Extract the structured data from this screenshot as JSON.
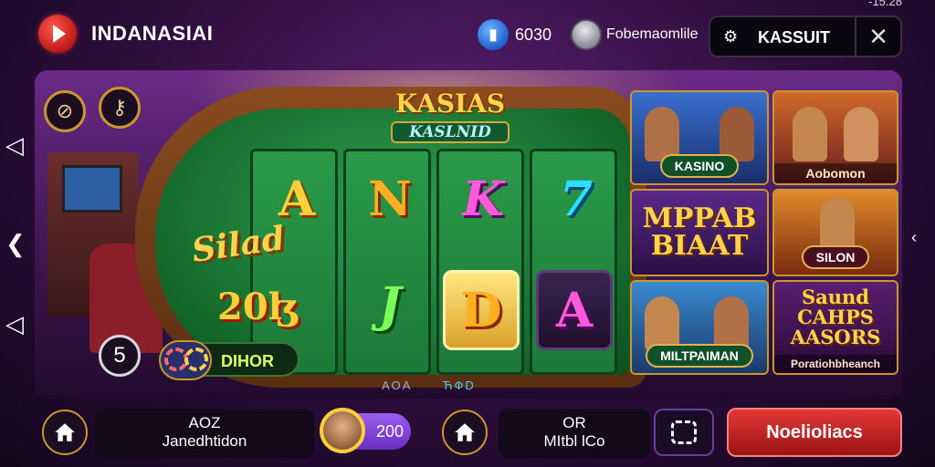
{
  "header": {
    "app_title": "INDANASIAI",
    "status_text": "-15.28",
    "coin_value": "6030",
    "user_name": "Fobemaomlile",
    "account_label": "KASSUIT",
    "close_glyph": "✕"
  },
  "game": {
    "title": "KASIAS",
    "subtitle": "KASLNID",
    "jackpot_label": "Silad",
    "jackpot_number": "20ɮ",
    "reels": [
      {
        "top": "A",
        "bottom": ""
      },
      {
        "top": "N",
        "bottom": "J"
      },
      {
        "top": "K",
        "bottom": "D"
      },
      {
        "top": "7",
        "bottom": "A"
      }
    ],
    "level": "5",
    "bonus_label": "DIHOR",
    "footer_left": "AOA",
    "footer_right": "ЋФD"
  },
  "tiles": [
    {
      "label": "KASINO"
    },
    {
      "label": "Aobomon"
    },
    {
      "label": "MPPAB BIAAT"
    },
    {
      "label": "SILON"
    },
    {
      "label": "MILTPAIMAN"
    },
    {
      "label": "Saund CAHPS AASORS",
      "sub": "Poratiohbheanch"
    }
  ],
  "bottom": {
    "left_panel_line1": "AOZ",
    "left_panel_line2": "Janedhtidon",
    "credit": "200",
    "right_panel_line1": "OR",
    "right_panel_line2": "MItbl lCo",
    "cta_label": "Noelioliacs"
  },
  "colors": {
    "accent_gold": "#c9982d",
    "cta_red": "#d02a2a",
    "felt_green": "#1f8a3d",
    "background_purple": "#3c154e"
  },
  "icons": [
    "play-logo-icon",
    "coin-icon",
    "user-avatar-icon",
    "gear-icon",
    "close-icon",
    "home-icon",
    "menu-icon",
    "music-off-icon",
    "key-icon"
  ]
}
